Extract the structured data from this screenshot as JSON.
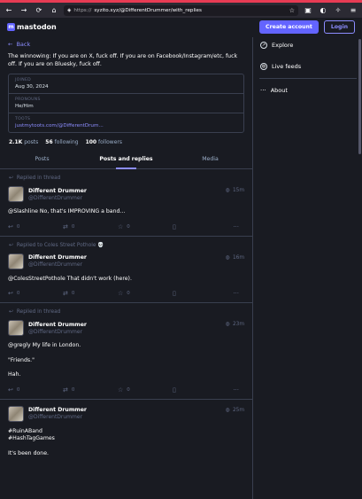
{
  "browser": {
    "url_prefix": "https://",
    "url_main": "syzito.xyz/@DifferentDrummer/with_replies"
  },
  "header": {
    "logo_text": "mastodon",
    "create_account": "Create account",
    "login": "Login"
  },
  "profile": {
    "back": "Back",
    "bio": "The winnowing: If you are on X, fuck off. If you are on Facebook/Instagram/etc, fuck off. If you are on Bluesky, fuck off.",
    "fields": [
      {
        "label": "JOINED",
        "value": "Aug 30, 2024"
      },
      {
        "label": "PRONOUNS",
        "value": "He/Him"
      },
      {
        "label": "TOOTS",
        "value": "justmytoots.com/@DifferentDrum..."
      }
    ],
    "counts": {
      "posts_num": "2.1K",
      "posts_lbl": "posts",
      "following_num": "56",
      "following_lbl": "following",
      "followers_num": "100",
      "followers_lbl": "followers"
    },
    "tabs": [
      "Posts",
      "Posts and replies",
      "Media"
    ]
  },
  "posts": [
    {
      "context": "Replied in thread",
      "name": "Different Drummer",
      "acct": "@DifferentDrummer",
      "time": "15m",
      "lines": [
        "@Slashline No, that's IMPROVING a band..."
      ],
      "replies": "0",
      "boosts": "0",
      "favs": "0"
    },
    {
      "context": "Replied to Coles Street Pothole 💀",
      "name": "Different Drummer",
      "acct": "@DifferentDrummer",
      "time": "16m",
      "lines": [
        "@ColesStreetPothole That didn't work (here)."
      ],
      "replies": "0",
      "boosts": "0",
      "favs": "0"
    },
    {
      "context": "Replied in thread",
      "name": "Different Drummer",
      "acct": "@DifferentDrummer",
      "time": "23m",
      "lines": [
        "@gregly My life in London.",
        "\"Friends.\"",
        "Hah."
      ],
      "replies": "0",
      "boosts": "0",
      "favs": "0"
    },
    {
      "context": "",
      "name": "Different Drummer",
      "acct": "@DifferentDrummer",
      "time": "25m",
      "lines": [
        "#RuinABand\n#HashTagGames",
        "It's been done."
      ],
      "replies": "",
      "boosts": "",
      "favs": ""
    }
  ],
  "sidebar": {
    "explore": "Explore",
    "live_feeds": "Live feeds",
    "about": "About"
  },
  "colors": {
    "accent": "#6364ff",
    "link": "#8c8dff",
    "bg": "#191b22",
    "muted": "#606984"
  }
}
